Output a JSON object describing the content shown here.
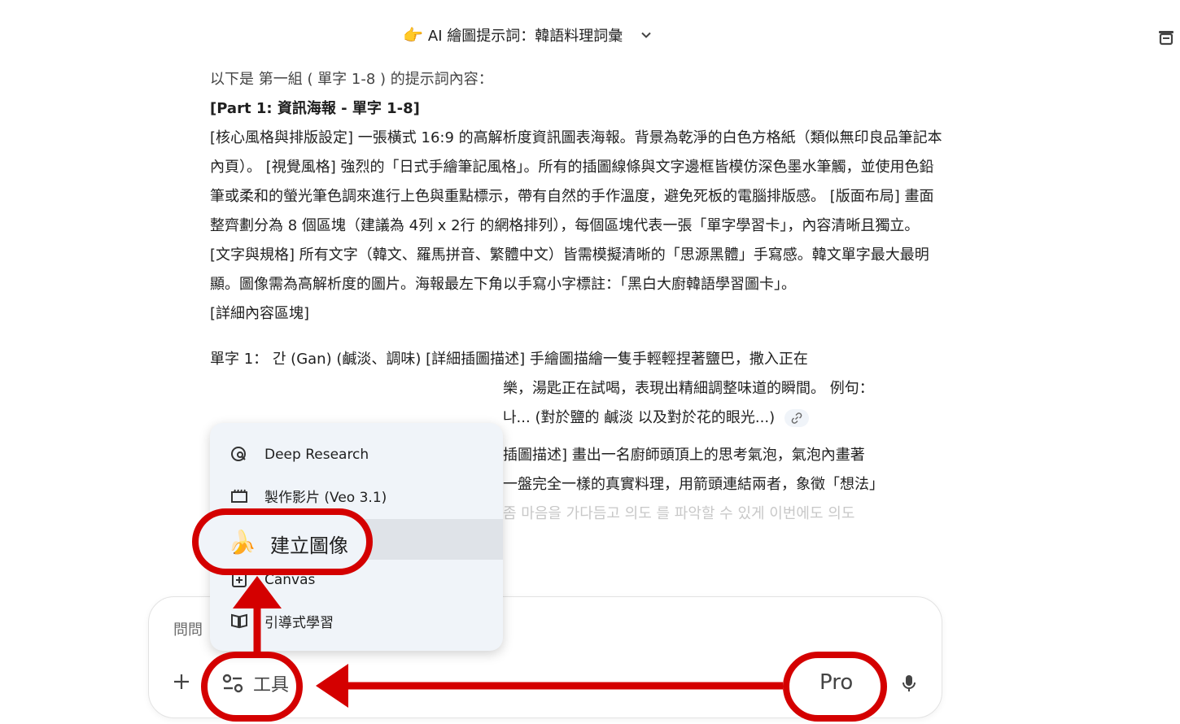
{
  "header": {
    "title_hand": "👉",
    "title": "AI 繪圖提示詞：韓語料理詞彙"
  },
  "content": {
    "intro": "以下是 第一組 ( 單字 1-8 ) 的提示詞內容：",
    "part_heading": "[Part 1: 資訊海報 - 單字 1-8]",
    "core_paragraph": "[核心風格與排版設定] 一張橫式 16:9 的高解析度資訊圖表海報。背景為乾淨的白色方格紙（類似無印良品筆記本內頁）。 [視覺風格] 強烈的「日式手繪筆記風格」。所有的插圖線條與文字邊框皆模仿深色墨水筆觸，並使用色鉛筆或柔和的螢光筆色調來進行上色與重點標示，帶有自然的手作溫度，避免死板的電腦排版感。 [版面布局] 畫面整齊劃分為 8 個區塊（建議為 4列 x 2行 的網格排列），每個區塊代表一張「單字學習卡」，內容清晰且獨立。 [文字與規格] 所有文字（韓文、羅馬拼音、繁體中文）皆需模擬清晰的「思源黑體」手寫感。韓文單字最大最明顯。圖像需為高解析度的圖片。海報最左下角以手寫小字標註：「黑白大廚韓語學習圖卡」。",
    "detail_heading": "[詳細內容區塊]",
    "rest_line1": "單字 1： 간 (Gan) (鹹淡、調味)   [詳細插圖描述] 手繪圖描繪一隻手輕輕捏著鹽巴，撒入正在",
    "rest_line2": "樂，湯匙正在試喝，表現出精細調整味道的瞬間。 例句：",
    "rest_line3": "나... (對於鹽的 鹹淡 以及對於花的眼光...)",
    "rest_line4": "插圖描述] 畫出一名廚師頭頂上的思考氣泡，氣泡內畫著",
    "rest_line5": "一盤完全一樣的真實料理，用箭頭連結兩者，象徵「想法」",
    "rest_line6": "좀 마음을 가다듬고 의도 를 파악할 수 있게 이번에도 의도"
  },
  "tools_menu": {
    "items": [
      {
        "label": "Deep Research",
        "icon": "deep-research-icon"
      },
      {
        "label": "製作影片 (Veo 3.1)",
        "icon": "video-clapper-icon"
      },
      {
        "label": "建立圖像",
        "icon": "banana-icon",
        "emoji": "🍌"
      },
      {
        "label": "Canvas",
        "icon": "canvas-icon"
      },
      {
        "label": "引導式學習",
        "icon": "book-icon"
      }
    ]
  },
  "input": {
    "placeholder": "問問",
    "tools_label": "工具",
    "mode_label": "Pro"
  },
  "colors": {
    "annotation_red": "#d40000",
    "menu_bg": "#f0f4f9",
    "menu_highlight": "#dfe3e8"
  }
}
